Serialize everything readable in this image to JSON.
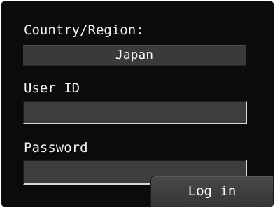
{
  "form": {
    "country_label": "Country/Region:",
    "country_value": "Japan",
    "userid_label": "User ID",
    "userid_value": "",
    "password_label": "Password",
    "password_value": ""
  },
  "actions": {
    "login_label": "Log in"
  }
}
